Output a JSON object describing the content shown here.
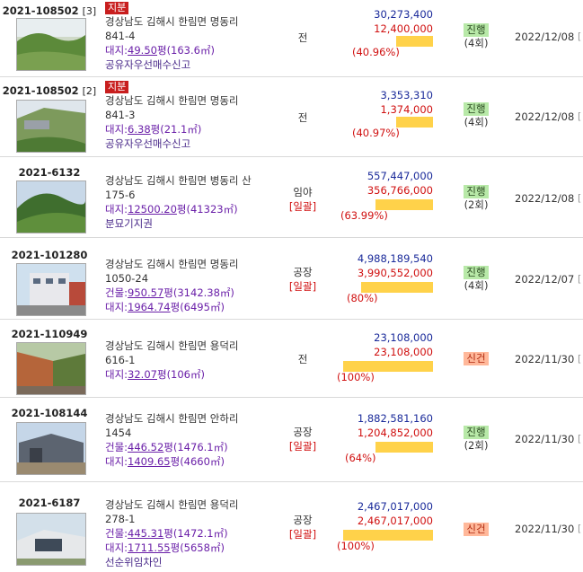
{
  "rows": [
    {
      "case_no": "2021-108502",
      "sub": "[3]",
      "share_badge": "지분",
      "addr1": "경상남도 김해시 한림면 명동리",
      "addr2": "841-4",
      "area_label": "대지:",
      "area_pyeong": "49.50",
      "area_rest": "평(163.6㎡)",
      "area2_label": "",
      "area2_pyeong": "",
      "area2_rest": "",
      "note": "공유자우선매수신고",
      "use": "전",
      "ilgwal": "",
      "appraisal": "30,273,400",
      "min_price": "12,400,000",
      "percent": "(40.96%)",
      "ratio": 40.96,
      "status": "진행",
      "status_color": "green",
      "count": "(4회)",
      "date": "2022/12/08",
      "edge": "["
    },
    {
      "case_no": "2021-108502",
      "sub": "[2]",
      "share_badge": "지분",
      "addr1": "경상남도 김해시 한림면 명동리",
      "addr2": "841-3",
      "area_label": "대지:",
      "area_pyeong": "6.38",
      "area_rest": "평(21.1㎡)",
      "area2_label": "",
      "area2_pyeong": "",
      "area2_rest": "",
      "note": "공유자우선매수신고",
      "use": "전",
      "ilgwal": "",
      "appraisal": "3,353,310",
      "min_price": "1,374,000",
      "percent": "(40.97%)",
      "ratio": 40.97,
      "status": "진행",
      "status_color": "green",
      "count": "(4회)",
      "date": "2022/12/08",
      "edge": "["
    },
    {
      "case_no": "2021-6132",
      "sub": "",
      "share_badge": "",
      "addr1": "경상남도 김해시 한림면 병동리 산",
      "addr2": "175-6",
      "area_label": "대지:",
      "area_pyeong": "12500.20",
      "area_rest": "평(41323㎡)",
      "area2_label": "",
      "area2_pyeong": "",
      "area2_rest": "",
      "note": "분묘기지권",
      "use": "임야",
      "ilgwal": "[일괄]",
      "appraisal": "557,447,000",
      "min_price": "356,766,000",
      "percent": "(63.99%)",
      "ratio": 63.99,
      "status": "진행",
      "status_color": "green",
      "count": "(2회)",
      "date": "2022/12/08",
      "edge": "["
    },
    {
      "case_no": "2021-101280",
      "sub": "",
      "share_badge": "",
      "addr1": "경상남도 김해시 한림면 명동리",
      "addr2": "1050-24",
      "area_label": "건물:",
      "area_pyeong": "950.57",
      "area_rest": "평(3142.38㎡)",
      "area2_label": "대지:",
      "area2_pyeong": "1964.74",
      "area2_rest": "평(6495㎡)",
      "note": "",
      "use": "공장",
      "ilgwal": "[일괄]",
      "appraisal": "4,988,189,540",
      "min_price": "3,990,552,000",
      "percent": "(80%)",
      "ratio": 80,
      "status": "진행",
      "status_color": "green",
      "count": "(4회)",
      "date": "2022/12/07",
      "edge": "["
    },
    {
      "case_no": "2021-110949",
      "sub": "",
      "share_badge": "",
      "addr1": "경상남도 김해시 한림면 용덕리",
      "addr2": "616-1",
      "area_label": "대지:",
      "area_pyeong": "32.07",
      "area_rest": "평(106㎡)",
      "area2_label": "",
      "area2_pyeong": "",
      "area2_rest": "",
      "note": "",
      "use": "전",
      "ilgwal": "",
      "appraisal": "23,108,000",
      "min_price": "23,108,000",
      "percent": "(100%)",
      "ratio": 100,
      "status": "신건",
      "status_color": "orange",
      "count": "",
      "date": "2022/11/30",
      "edge": "["
    },
    {
      "case_no": "2021-108144",
      "sub": "",
      "share_badge": "",
      "addr1": "경상남도 김해시 한림면 안하리",
      "addr2": "1454",
      "area_label": "건물:",
      "area_pyeong": "446.52",
      "area_rest": "평(1476.1㎡)",
      "area2_label": "대지:",
      "area2_pyeong": "1409.65",
      "area2_rest": "평(4660㎡)",
      "note": "",
      "use": "공장",
      "ilgwal": "[일괄]",
      "appraisal": "1,882,581,160",
      "min_price": "1,204,852,000",
      "percent": "(64%)",
      "ratio": 64,
      "status": "진행",
      "status_color": "green",
      "count": "(2회)",
      "date": "2022/11/30",
      "edge": "["
    },
    {
      "case_no": "2021-6187",
      "sub": "",
      "share_badge": "",
      "addr1": "경상남도 김해시 한림면 용덕리",
      "addr2": "278-1",
      "area_label": "건물:",
      "area_pyeong": "445.31",
      "area_rest": "평(1472.1㎡)",
      "area2_label": "대지:",
      "area2_pyeong": "1711.55",
      "area2_rest": "평(5658㎡)",
      "note": "선순위임차인",
      "use": "공장",
      "ilgwal": "[일괄]",
      "appraisal": "2,467,017,000",
      "min_price": "2,467,017,000",
      "percent": "(100%)",
      "ratio": 100,
      "status": "신건",
      "status_color": "orange",
      "count": "",
      "date": "2022/11/30",
      "edge": "["
    }
  ],
  "colors": {
    "approval": "#1a2a9a",
    "minimum": "#d01010",
    "bar": "#ffd24a",
    "area": "#6a1fa8"
  }
}
